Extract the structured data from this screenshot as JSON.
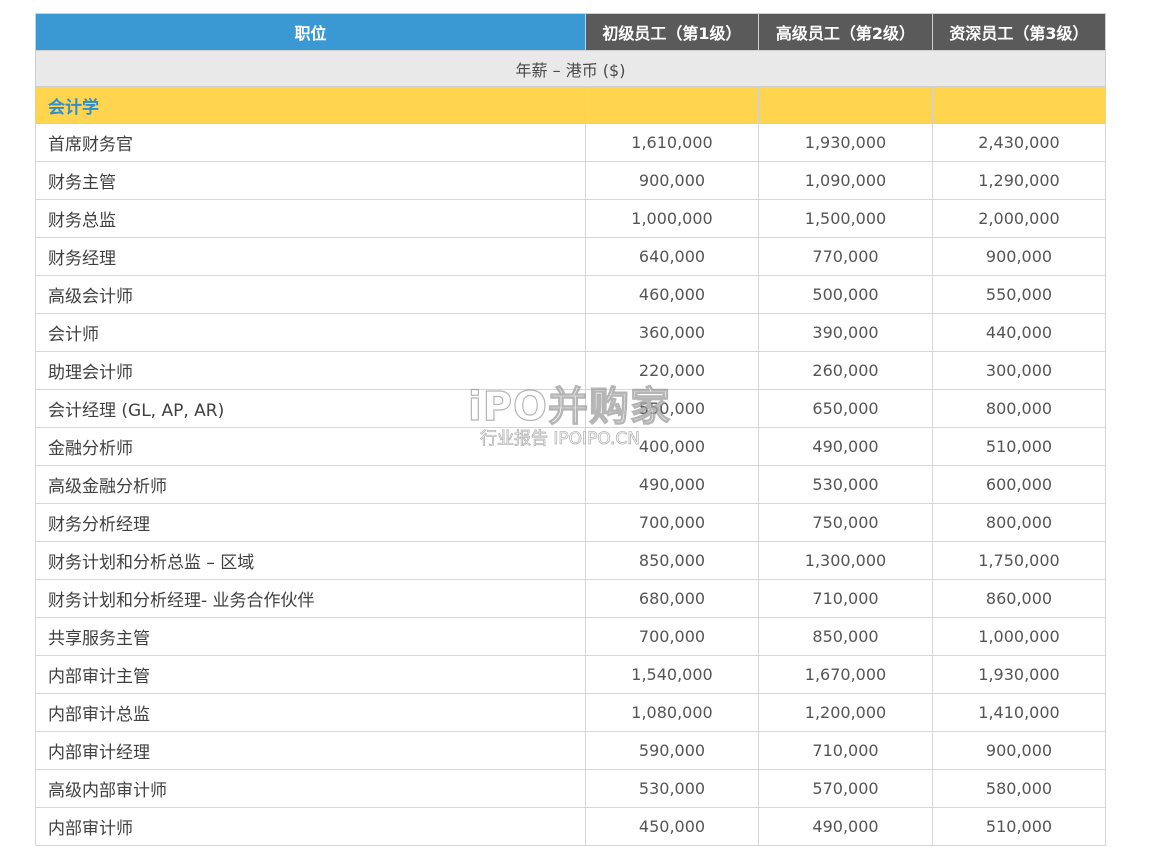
{
  "table": {
    "headers": {
      "role": "职位",
      "level1": "初级员工（第1级）",
      "level2": "高级员工（第2级）",
      "level3": "资深员工（第3级）"
    },
    "currency_label": "年薪 – 港币 ($)",
    "section_title": "会计学",
    "rows": [
      {
        "role": "首席财务官",
        "l1": "1,610,000",
        "l2": "1,930,000",
        "l3": "2,430,000"
      },
      {
        "role": "财务主管",
        "l1": "900,000",
        "l2": "1,090,000",
        "l3": "1,290,000"
      },
      {
        "role": "财务总监",
        "l1": "1,000,000",
        "l2": "1,500,000",
        "l3": "2,000,000"
      },
      {
        "role": "财务经理",
        "l1": "640,000",
        "l2": "770,000",
        "l3": "900,000"
      },
      {
        "role": "高级会计师",
        "l1": "460,000",
        "l2": "500,000",
        "l3": "550,000"
      },
      {
        "role": "会计师",
        "l1": "360,000",
        "l2": "390,000",
        "l3": "440,000"
      },
      {
        "role": "助理会计师",
        "l1": "220,000",
        "l2": "260,000",
        "l3": "300,000"
      },
      {
        "role": "会计经理 (GL, AP, AR)",
        "l1": "550,000",
        "l2": "650,000",
        "l3": "800,000"
      },
      {
        "role": "金融分析师",
        "l1": "400,000",
        "l2": "490,000",
        "l3": "510,000"
      },
      {
        "role": "高级金融分析师",
        "l1": "490,000",
        "l2": "530,000",
        "l3": "600,000"
      },
      {
        "role": "财务分析经理",
        "l1": "700,000",
        "l2": "750,000",
        "l3": "800,000"
      },
      {
        "role": "财务计划和分析总监 – 区域",
        "l1": "850,000",
        "l2": "1,300,000",
        "l3": "1,750,000"
      },
      {
        "role": "财务计划和分析经理- 业务合作伙伴",
        "l1": "680,000",
        "l2": "710,000",
        "l3": "860,000"
      },
      {
        "role": "共享服务主管",
        "l1": "700,000",
        "l2": "850,000",
        "l3": "1,000,000"
      },
      {
        "role": "内部审计主管",
        "l1": "1,540,000",
        "l2": "1,670,000",
        "l3": "1,930,000"
      },
      {
        "role": "内部审计总监",
        "l1": "1,080,000",
        "l2": "1,200,000",
        "l3": "1,410,000"
      },
      {
        "role": "内部审计经理",
        "l1": "590,000",
        "l2": "710,000",
        "l3": "900,000"
      },
      {
        "role": "高级内部审计师",
        "l1": "530,000",
        "l2": "570,000",
        "l3": "580,000"
      },
      {
        "role": "内部审计师",
        "l1": "450,000",
        "l2": "490,000",
        "l3": "510,000"
      }
    ]
  },
  "watermark": {
    "main": "iPO并购家",
    "sub": "行业报告 IPOIPO.CN"
  },
  "colors": {
    "role_header_bg": "#3a98d3",
    "level_header_bg": "#5a5a5a",
    "currency_row_bg": "#e9e9e9",
    "section_row_bg": "#ffd54f",
    "section_text": "#2f8fcc"
  }
}
